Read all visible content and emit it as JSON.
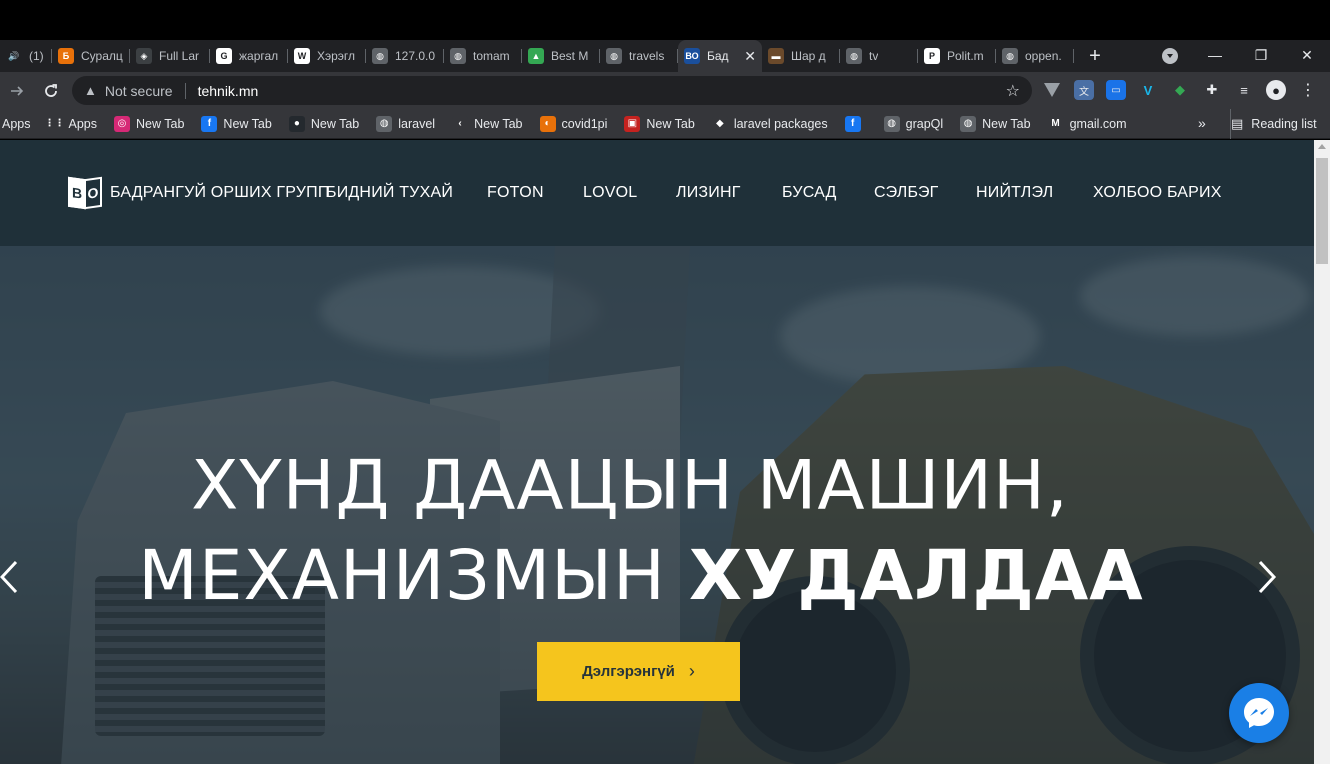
{
  "browser": {
    "tabs": [
      {
        "title": "(1)",
        "icon": "speaker-icon",
        "color": "#202124",
        "glyph": "🔊"
      },
      {
        "title": "Суралц",
        "icon": "app-icon",
        "color": "#e8710a",
        "glyph": "Б"
      },
      {
        "title": "Full Lar",
        "icon": "app-icon",
        "color": "#3c4043",
        "glyph": "◈"
      },
      {
        "title": "жаргал",
        "icon": "google-icon",
        "color": "#ffffff",
        "glyph": "G"
      },
      {
        "title": "Хэрэгл",
        "icon": "wikipedia-icon",
        "color": "#ffffff",
        "glyph": "W"
      },
      {
        "title": "127.0.0",
        "icon": "globe-icon",
        "color": "#5f6368",
        "glyph": "◍"
      },
      {
        "title": "tomam",
        "icon": "globe-icon",
        "color": "#5f6368",
        "glyph": "◍"
      },
      {
        "title": "Best M",
        "icon": "app-icon",
        "color": "#34a853",
        "glyph": "▲"
      },
      {
        "title": "travels",
        "icon": "globe-icon",
        "color": "#5f6368",
        "glyph": "◍"
      },
      {
        "title": "Бад",
        "icon": "site-icon",
        "color": "#1a4f9c",
        "glyph": "ВО",
        "active": true
      },
      {
        "title": "Шар д",
        "icon": "app-icon",
        "color": "#6b4a2b",
        "glyph": "▬"
      },
      {
        "title": "tv",
        "icon": "globe-icon",
        "color": "#5f6368",
        "glyph": "◍"
      },
      {
        "title": "Polit.m",
        "icon": "app-icon",
        "color": "#ffffff",
        "glyph": "P"
      },
      {
        "title": "oppen.",
        "icon": "globe-icon",
        "color": "#5f6368",
        "glyph": "◍"
      }
    ],
    "tab_close": "✕",
    "new_tab": "+",
    "window": {
      "minimize": "—",
      "maximize": "❐",
      "close": "✕"
    },
    "address": {
      "warning": "▲",
      "security_label": "Not secure",
      "url": "tehnik.mn"
    },
    "bookmarks": [
      {
        "label": "Apps",
        "icon": "apps-grid-icon",
        "color": "#35363a",
        "glyph": "⋮⋮"
      },
      {
        "label": "New Tab",
        "icon": "instagram-icon",
        "color": "#d62976",
        "glyph": "◎"
      },
      {
        "label": "New Tab",
        "icon": "facebook-icon",
        "color": "#1877f2",
        "glyph": "f"
      },
      {
        "label": "New Tab",
        "icon": "github-icon",
        "color": "#24292e",
        "glyph": "●"
      },
      {
        "label": "laravel",
        "icon": "globe-icon",
        "color": "#5f6368",
        "glyph": "◍"
      },
      {
        "label": "New Tab",
        "icon": "app-icon",
        "color": "#35363a",
        "glyph": "‹"
      },
      {
        "label": "covid1pi",
        "icon": "app-icon",
        "color": "#e8710a",
        "glyph": "◐"
      },
      {
        "label": "New Tab",
        "icon": "app-icon",
        "color": "#c5221f",
        "glyph": "▣"
      },
      {
        "label": "laravel packages",
        "icon": "app-icon",
        "color": "#35363a",
        "glyph": "◆"
      },
      {
        "label": "",
        "icon": "facebook-icon",
        "color": "#1877f2",
        "glyph": "f"
      },
      {
        "label": "grapQl",
        "icon": "globe-icon",
        "color": "#5f6368",
        "glyph": "◍"
      },
      {
        "label": "New Tab",
        "icon": "globe-icon",
        "color": "#5f6368",
        "glyph": "◍"
      },
      {
        "label": "gmail.com",
        "icon": "gmail-icon",
        "color": "#35363a",
        "glyph": "M"
      }
    ],
    "bookmarks_prefix": "Apps",
    "bookmarks_more": "»",
    "reading_list": "Reading list"
  },
  "site": {
    "logo_text": "БАДРАНГУЙ ОРШИХ ГРУПП",
    "logo_letters": [
      "В",
      "О"
    ],
    "menu": [
      "БИДНИЙ ТУХАЙ",
      "FOTON",
      "LOVOL",
      "ЛИЗИНГ",
      "БУСАД",
      "СЭЛБЭГ",
      "НИЙТЛЭЛ",
      "ХОЛБОО БАРИХ"
    ],
    "hero": {
      "line1": "ХҮНД ДААЦЫН МАШИН,",
      "line2_light": "МЕХАНИЗМЫН ",
      "line2_bold": "ХУДАЛДАА",
      "button_label": "Дэлгэрэнгүй",
      "button_chevron": "›"
    },
    "colors": {
      "accent": "#f5c51d",
      "nav_bg": "#1f3039",
      "messenger": "#1a7fe6"
    }
  }
}
